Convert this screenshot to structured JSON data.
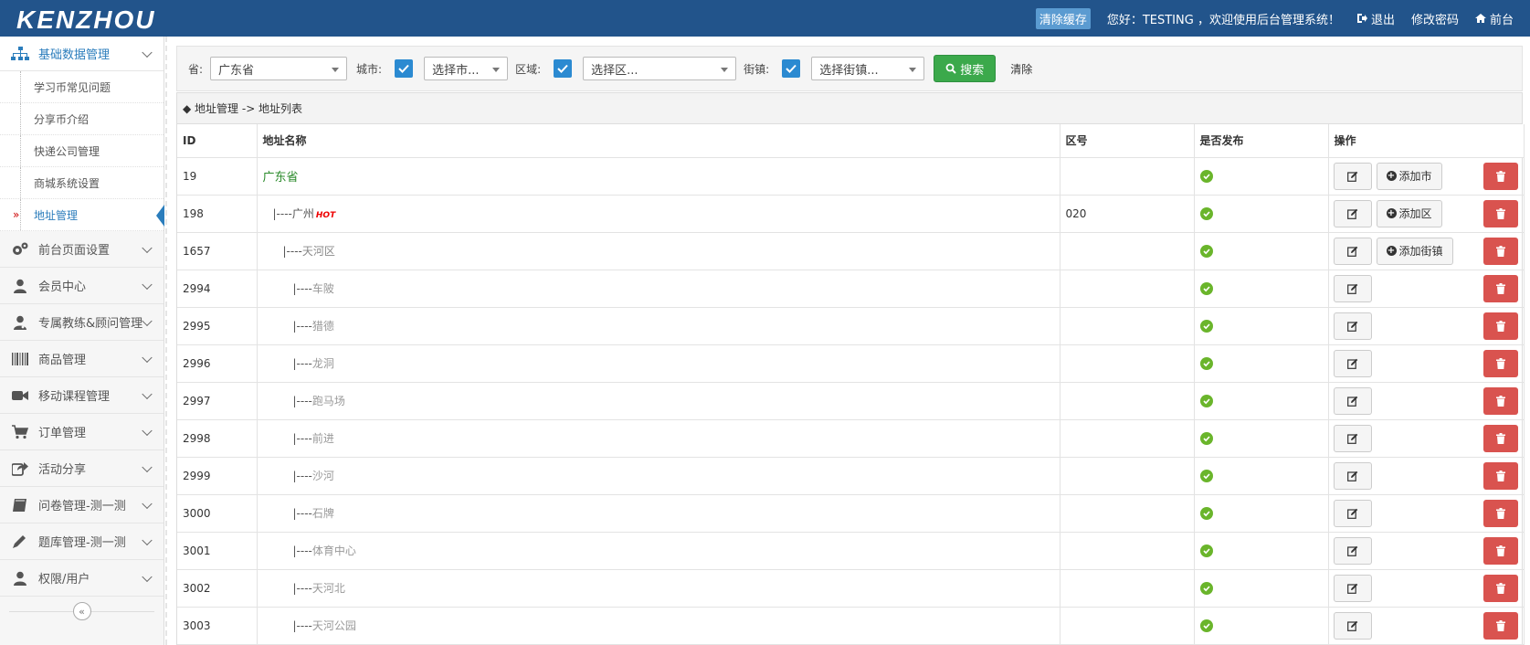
{
  "topbar": {
    "logo": "KENZHOU",
    "clear_cache": "清除缓存",
    "welcome": "您好：TESTING ，欢迎使用后台管理系统！",
    "logout": "退出",
    "change_password": "修改密码",
    "frontend": "前台"
  },
  "sidebar": {
    "head": "基础数据管理",
    "sub_items": [
      {
        "label": "学习币常见问题"
      },
      {
        "label": "分享币介绍"
      },
      {
        "label": "快递公司管理"
      },
      {
        "label": "商城系统设置"
      },
      {
        "label": "地址管理",
        "active": true
      }
    ],
    "menu": [
      {
        "label": "前台页面设置",
        "icon": "gears-icon"
      },
      {
        "label": "会员中心",
        "icon": "user-icon"
      },
      {
        "label": "专属教练&顾问管理",
        "icon": "user-md-icon"
      },
      {
        "label": "商品管理",
        "icon": "barcode-icon"
      },
      {
        "label": "移动课程管理",
        "icon": "video-camera-icon"
      },
      {
        "label": "订单管理",
        "icon": "shopping-cart-icon"
      },
      {
        "label": "活动分享",
        "icon": "share-icon"
      },
      {
        "label": "问卷管理-测一测",
        "icon": "book-icon"
      },
      {
        "label": "题库管理-测一测",
        "icon": "pencil-icon"
      },
      {
        "label": "权限/用户",
        "icon": "user-icon"
      }
    ],
    "collapse_glyph": "«"
  },
  "filter": {
    "province_label": "省:",
    "province_value": "广东省",
    "city_label": "城市:",
    "city_placeholder": "选择市...",
    "district_label": "区域:",
    "district_placeholder": "选择区...",
    "street_label": "街镇:",
    "street_placeholder": "选择街镇...",
    "search_label": "搜索",
    "clear_label": "清除"
  },
  "breadcrumb": "◆ 地址管理 -> 地址列表",
  "table": {
    "headers": [
      "ID",
      "地址名称",
      "区号",
      "是否发布",
      "操作"
    ],
    "rows": [
      {
        "id": "19",
        "prefix": "",
        "name": "广东省",
        "code": "",
        "level": "prov",
        "add": "添加市"
      },
      {
        "id": "198",
        "prefix": "|----",
        "name": "广州",
        "hot": "HOT",
        "code": "020",
        "level": "city",
        "add": "添加区"
      },
      {
        "id": "1657",
        "prefix": "|----",
        "name": "天河区",
        "code": "",
        "level": "area",
        "add": "添加街镇"
      },
      {
        "id": "2994",
        "prefix": "|----",
        "name": "车陂",
        "code": "",
        "level": "sub",
        "add": ""
      },
      {
        "id": "2995",
        "prefix": "|----",
        "name": "猎德",
        "code": "",
        "level": "sub",
        "add": ""
      },
      {
        "id": "2996",
        "prefix": "|----",
        "name": "龙洞",
        "code": "",
        "level": "sub",
        "add": ""
      },
      {
        "id": "2997",
        "prefix": "|----",
        "name": "跑马场",
        "code": "",
        "level": "sub",
        "add": ""
      },
      {
        "id": "2998",
        "prefix": "|----",
        "name": "前进",
        "code": "",
        "level": "sub",
        "add": ""
      },
      {
        "id": "2999",
        "prefix": "|----",
        "name": "沙河",
        "code": "",
        "level": "sub",
        "add": ""
      },
      {
        "id": "3000",
        "prefix": "|----",
        "name": "石牌",
        "code": "",
        "level": "sub",
        "add": ""
      },
      {
        "id": "3001",
        "prefix": "|----",
        "name": "体育中心",
        "code": "",
        "level": "sub",
        "add": ""
      },
      {
        "id": "3002",
        "prefix": "|----",
        "name": "天河北",
        "code": "",
        "level": "sub",
        "add": ""
      },
      {
        "id": "3003",
        "prefix": "|----",
        "name": "天河公园",
        "code": "",
        "level": "sub",
        "add": ""
      }
    ]
  },
  "colors": {
    "topbar": "#22548b",
    "accent": "#2b7dbc",
    "success": "#3ba94b",
    "danger": "#d9534f"
  }
}
